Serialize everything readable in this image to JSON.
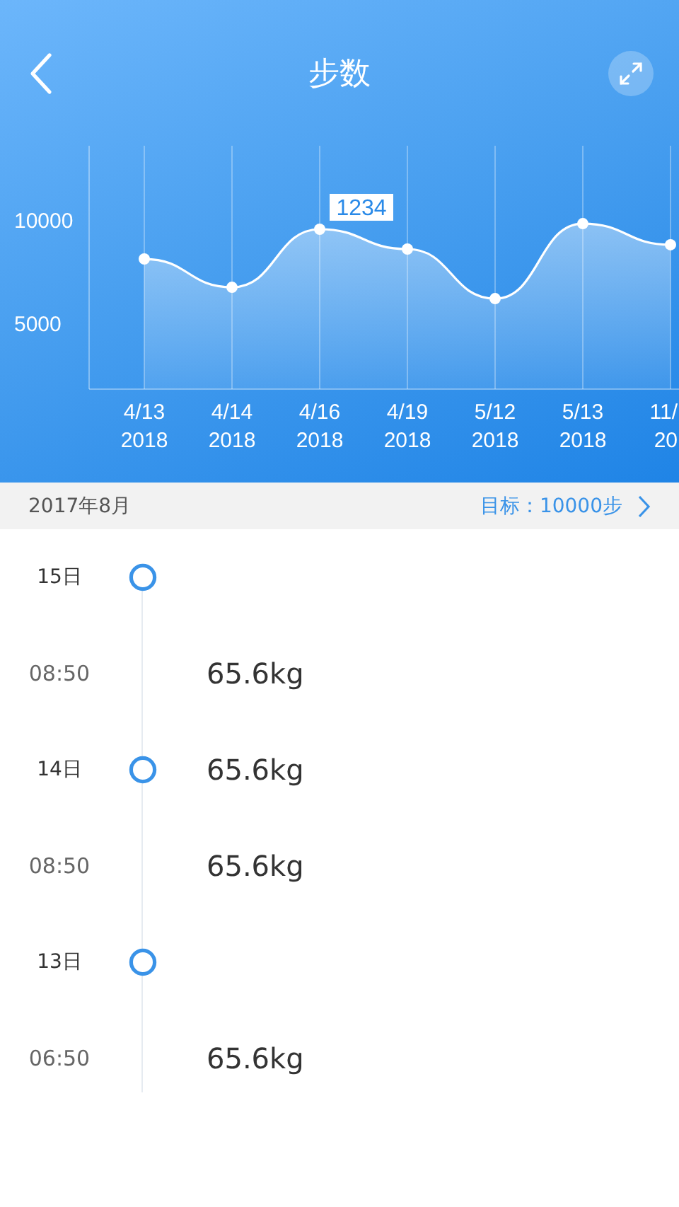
{
  "header": {
    "title": "步数"
  },
  "chart": {
    "chart_data": {
      "type": "area",
      "categories": [
        "4/13\n2018",
        "4/14\n2018",
        "4/16\n2018",
        "4/19\n2018",
        "5/12\n2018",
        "5/13\n2018",
        "11/\n20"
      ],
      "series": [
        {
          "color": "#ffffff",
          "values": [
            8080,
            6710,
            9520,
            8560,
            6160,
            9790,
            8770
          ]
        }
      ],
      "ylim": [
        1780,
        13560
      ],
      "yticks": [
        5000,
        10000
      ],
      "grid": true,
      "annotations": [
        {
          "x": "4/16\n2018",
          "y": 9520,
          "text": "1234"
        }
      ]
    }
  },
  "summary": {
    "month": "2017年8月",
    "goal": "目标：10000步"
  },
  "records": [
    {
      "kind": "day",
      "label": "15日"
    },
    {
      "kind": "time",
      "label": "08:50",
      "value": "65.6kg"
    },
    {
      "kind": "day",
      "label": "14日",
      "value": "65.6kg"
    },
    {
      "kind": "time",
      "label": "08:50",
      "value": "65.6kg"
    },
    {
      "kind": "day",
      "label": "13日"
    },
    {
      "kind": "time",
      "label": "06:50",
      "value": "65.6kg"
    }
  ]
}
